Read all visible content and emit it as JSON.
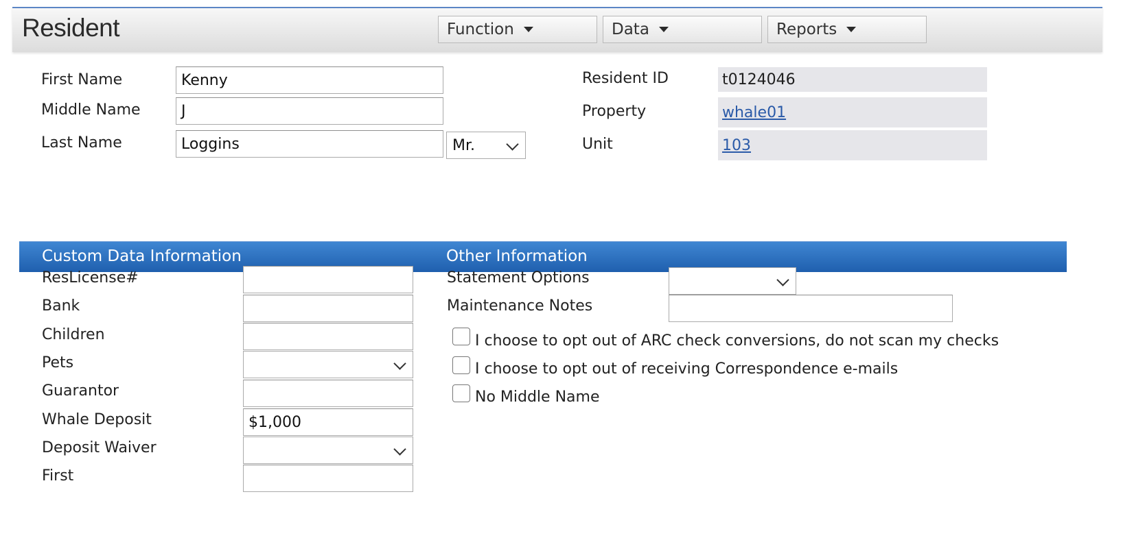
{
  "header": {
    "title": "Resident",
    "menus": [
      {
        "label": "Function",
        "icon": "caret-down-icon"
      },
      {
        "label": "Data",
        "icon": "caret-down-icon"
      },
      {
        "label": "Reports",
        "icon": "caret-down-icon"
      }
    ]
  },
  "name_section": {
    "first_name_label": "First Name",
    "first_name_value": "Kenny",
    "middle_name_label": "Middle Name",
    "middle_name_value": "J",
    "last_name_label": "Last Name",
    "last_name_value": "Loggins",
    "salutation_value": "Mr."
  },
  "id_section": {
    "resident_id_label": "Resident ID",
    "resident_id_value": "t0124046",
    "property_label": "Property",
    "property_value": "whale01",
    "unit_label": "Unit",
    "unit_value": "103"
  },
  "custom_data": {
    "title": "Custom Data Information",
    "fields": [
      {
        "label": "ResLicense#",
        "value": ""
      },
      {
        "label": "Bank",
        "value": ""
      },
      {
        "label": "Children",
        "value": ""
      },
      {
        "label": "Pets",
        "value": ""
      },
      {
        "label": "Guarantor",
        "value": ""
      },
      {
        "label": "Whale Deposit",
        "value": "$1,000"
      },
      {
        "label": "Deposit Waiver",
        "value": ""
      },
      {
        "label": "First",
        "value": ""
      }
    ]
  },
  "other_info": {
    "title": "Other Information",
    "statement_options_label": "Statement Options",
    "statement_options_value": "",
    "maintenance_notes_label": "Maintenance Notes",
    "maintenance_notes_value": "",
    "checkboxes": [
      {
        "label": "I choose to opt out of ARC check conversions, do not scan my checks",
        "checked": false
      },
      {
        "label": "I choose to opt out of receiving Correspondence e-mails",
        "checked": false
      },
      {
        "label": "No Middle Name",
        "checked": false
      }
    ]
  },
  "colors": {
    "band": "#1f5fae",
    "link": "#2a5aa8",
    "readonly_bg": "#e6e6ea"
  }
}
